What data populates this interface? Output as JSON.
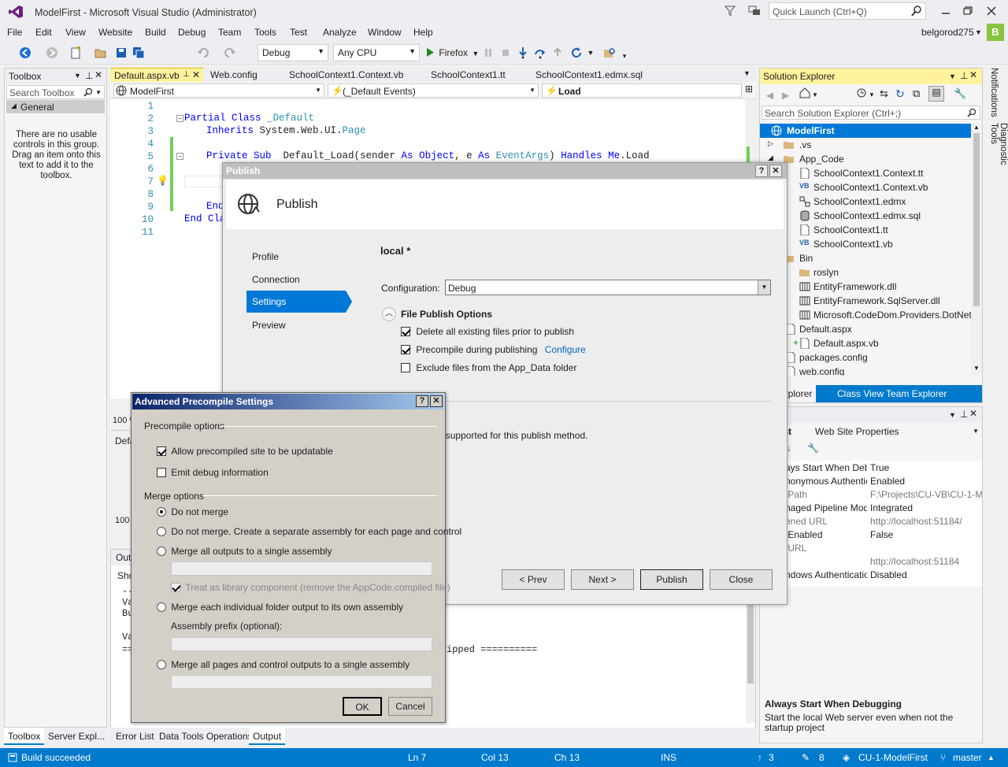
{
  "window": {
    "title": "ModelFirst - Microsoft Visual Studio  (Administrator)",
    "quick_launch_placeholder": "Quick Launch (Ctrl+Q)",
    "user": "belgorod275",
    "user_initial": "B"
  },
  "menu": [
    "File",
    "Edit",
    "View",
    "Website",
    "Build",
    "Debug",
    "Team",
    "Tools",
    "Test",
    "Analyze",
    "Window",
    "Help"
  ],
  "toolbar": {
    "config": "Debug",
    "platform": "Any CPU",
    "run_target": "Firefox"
  },
  "toolbox": {
    "title": "Toolbox",
    "search_placeholder": "Search Toolbox",
    "group": "General",
    "empty_text": "There are no usable controls in this group. Drag an item onto this text to add it to the toolbox."
  },
  "editor": {
    "tabs": [
      "Default.aspx.vb",
      "Web.config",
      "SchoolContext1.Context.vb",
      "SchoolContext1.tt",
      "SchoolContext1.edmx.sql"
    ],
    "nav_project": "ModelFirst",
    "nav_events": "(_Default Events)",
    "nav_member": "Load",
    "line_numbers": [
      "1",
      "2",
      "3",
      "4",
      "5",
      "6",
      "7",
      "8",
      "9",
      "10",
      "11"
    ],
    "code": {
      "l2_kw": "Partial Class",
      "l2_name": " _Default",
      "l3_kw": "Inherits",
      "l3_a": " System.Web.UI.",
      "l3_b": "Page",
      "l5_kw1": "Private Sub",
      "l5_a": "  Default_Load(sender ",
      "l5_kw2": "As",
      "l5_kw3": " Object",
      "l5_b": ", e ",
      "l5_kw4": "As",
      "l5_ty": " EventArgs",
      "l5_c": ") ",
      "l5_kw5": "Handles",
      "l5_kw6": " Me",
      "l5_d": ".Load",
      "l9": "End",
      "l10": "End Cla"
    },
    "zoom": "100 %"
  },
  "publish": {
    "title": "Publish",
    "header": "Publish",
    "nav": [
      "Profile",
      "Connection",
      "Settings",
      "Preview"
    ],
    "active_nav": "Settings",
    "profile_name": "local *",
    "configuration_label": "Configuration:",
    "configuration_value": "Debug",
    "file_publish_options": "File Publish Options",
    "opt_delete": "Delete all existing files prior to publish",
    "opt_precompile": "Precompile during publishing",
    "configure_link": "Configure",
    "opt_exclude": "Exclude files from the App_Data folder",
    "db_note": "ublishing is not supported for this publish method.",
    "btn_prev": "< Prev",
    "btn_next": "Next >",
    "btn_publish": "Publish",
    "btn_close": "Close"
  },
  "precompile": {
    "title": "Advanced Precompile Settings",
    "precompile_options": "Precompile options",
    "allow_updatable": "Allow precompiled site to be updatable",
    "emit_debug": "Emit debug information",
    "merge_options": "Merge options",
    "r_no_merge": "Do not merge",
    "r_separate": "Do not merge. Create a separate assembly for each page and control",
    "r_single": "Merge all outputs to a single assembly",
    "treat_library": "Treat as library component (remove the AppCode.compiled file)",
    "r_folder": "Merge each individual folder output to its own assembly",
    "assembly_prefix": "Assembly prefix (optional):",
    "r_pages": "Merge all pages and control outputs to a single assembly",
    "btn_ok": "OK",
    "btn_cancel": "Cancel"
  },
  "solution_explorer": {
    "title": "Solution Explorer",
    "search_placeholder": "Search Solution Explorer (Ctrl+;)",
    "items": [
      {
        "label": "ModelFirst",
        "icon": "globe-icon"
      },
      {
        "label": ".vs",
        "icon": "folder-icon"
      },
      {
        "label": "App_Code",
        "icon": "folder-icon"
      },
      {
        "label": "SchoolContext1.Context.tt",
        "icon": "file-icon"
      },
      {
        "label": "SchoolContext1.Context.vb",
        "icon": "vb-file-icon"
      },
      {
        "label": "SchoolContext1.edmx",
        "icon": "edmx-icon"
      },
      {
        "label": "SchoolContext1.edmx.sql",
        "icon": "database-icon"
      },
      {
        "label": "SchoolContext1.tt",
        "icon": "file-icon"
      },
      {
        "label": "SchoolContext1.vb",
        "icon": "vb-file-icon"
      },
      {
        "label": "Bin",
        "icon": "folder-icon"
      },
      {
        "label": "roslyn",
        "icon": "folder-icon"
      },
      {
        "label": "EntityFramework.dll",
        "icon": "dll-icon"
      },
      {
        "label": "EntityFramework.SqlServer.dll",
        "icon": "dll-icon"
      },
      {
        "label": "Microsoft.CodeDom.Providers.DotNetCon",
        "icon": "dll-icon"
      },
      {
        "label": "Default.aspx",
        "icon": "file-icon"
      },
      {
        "label": "Default.aspx.vb",
        "icon": "file-icon"
      },
      {
        "label": "packages.config",
        "icon": "file-icon"
      },
      {
        "label": "web.config",
        "icon": "file-icon"
      }
    ],
    "tabs": [
      "on Explorer",
      "Class View",
      "Team Explorer"
    ]
  },
  "properties": {
    "title": "rties",
    "object": "elFirst",
    "object_type": "Web Site Properties",
    "rows": [
      {
        "name": "ays Start When Debu",
        "value": "True",
        "dim": false
      },
      {
        "name": "nonymous Authenticati",
        "value": "Enabled",
        "dim": false
      },
      {
        "name": " Path",
        "value": "F:\\Projects\\CU-VB\\CU-1-Mode",
        "dim": true
      },
      {
        "name": "naged Pipeline Mode",
        "value": "Integrated",
        "dim": false
      },
      {
        "name": "ened URL",
        "value": "http://localhost:51184/",
        "dim": true
      },
      {
        "name": " Enabled",
        "value": "False",
        "dim": false
      },
      {
        "name": " URL",
        "value": "",
        "dim": true
      },
      {
        "name": "",
        "value": "http://localhost:51184",
        "dim": true
      },
      {
        "name": "ndows Authentication",
        "value": "Disabled",
        "dim": false
      }
    ],
    "desc_title": "Always Start When Debugging",
    "desc_text": "Start the local Web server even when not the startup project"
  },
  "output": {
    "header": "Out",
    "show_label": "Sho",
    "line_dashes": "--",
    "line_va1": "Va",
    "line_bu": "Bu",
    "line_va2": "Va",
    "line_eq": "==",
    "skipped": "ipped =========="
  },
  "bottom_tabs": {
    "left": [
      "Toolbox",
      "Server Expl..."
    ],
    "mid": [
      "Error List",
      "Data Tools Operations",
      "Output"
    ]
  },
  "side_tabs": [
    "Notifications",
    "Diagnostic Tools"
  ],
  "status": {
    "message": "Build succeeded",
    "ln": "Ln 7",
    "col": "Col 13",
    "ch": "Ch 13",
    "ins": "INS",
    "up": "3",
    "pencil": "8",
    "repo": "CU-1-ModelFirst",
    "branch": "master"
  },
  "colors": {
    "accent": "#007acc",
    "status": "#007acc",
    "selection": "#0078d7"
  }
}
